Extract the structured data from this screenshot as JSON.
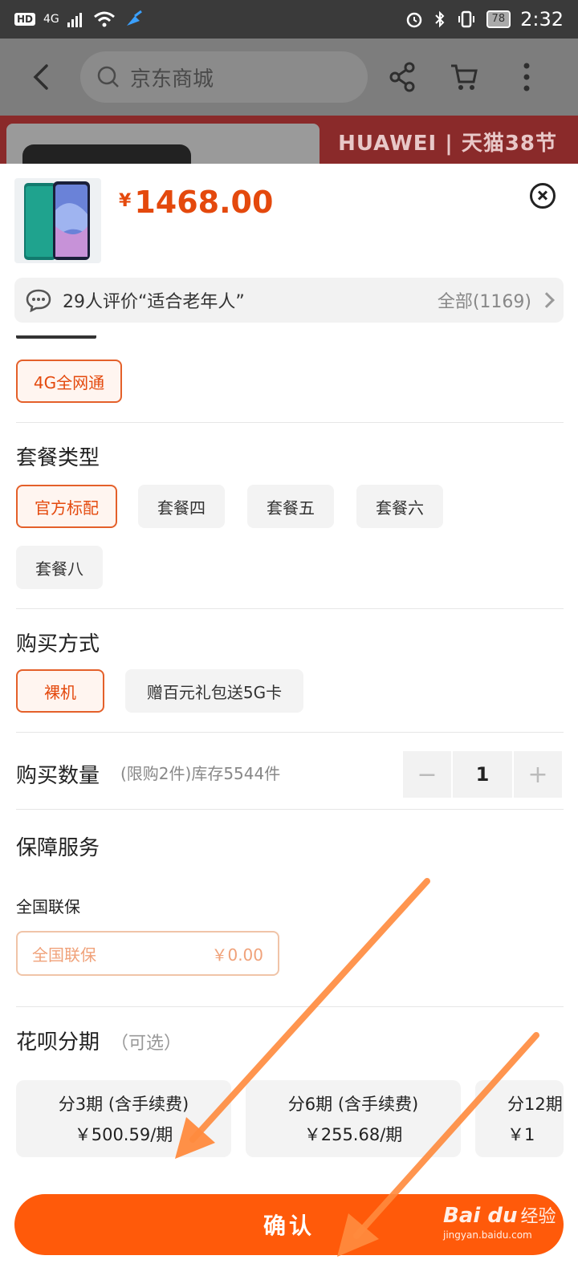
{
  "status_bar": {
    "network": "4G",
    "battery": "78",
    "time": "2:32"
  },
  "header": {
    "search_placeholder": "京东商城"
  },
  "banner": {
    "brand_text": "HUAWEI | 天猫38节"
  },
  "product": {
    "price_symbol": "¥",
    "price": "1468.00"
  },
  "reviews": {
    "summary": "29人评价“适合老年人”",
    "all_label": "全部(1169)"
  },
  "network_type": {
    "options": [
      "4G全网通"
    ]
  },
  "package": {
    "title": "套餐类型",
    "options": [
      "官方标配",
      "套餐四",
      "套餐五",
      "套餐六",
      "套餐八"
    ]
  },
  "purchase_method": {
    "title": "购买方式",
    "options": [
      "裸机",
      "赠百元礼包送5G卡"
    ]
  },
  "quantity": {
    "title": "购买数量",
    "note": "(限购2件)库存5544件",
    "minus": "−",
    "value": "1",
    "plus": "+"
  },
  "service": {
    "title": "保障服务",
    "label": "全国联保",
    "option_name": "全国联保",
    "option_price": "￥0.00"
  },
  "installment": {
    "title": "花呗分期",
    "note": "（可选）",
    "plans": [
      {
        "term": "分3期 (含手续费)",
        "amount": "￥500.59/期"
      },
      {
        "term": "分6期 (含手续费)",
        "amount": "￥255.68/期"
      },
      {
        "term": "分12期",
        "amount": "￥1"
      }
    ]
  },
  "confirm_button": "确认",
  "watermark": {
    "brand": "Bai du",
    "cn": "经验",
    "url": "jingyan.baidu.com"
  },
  "colors": {
    "accent": "#ff5a0a",
    "price": "#e4490d",
    "arrow": "#ff8a3d"
  }
}
